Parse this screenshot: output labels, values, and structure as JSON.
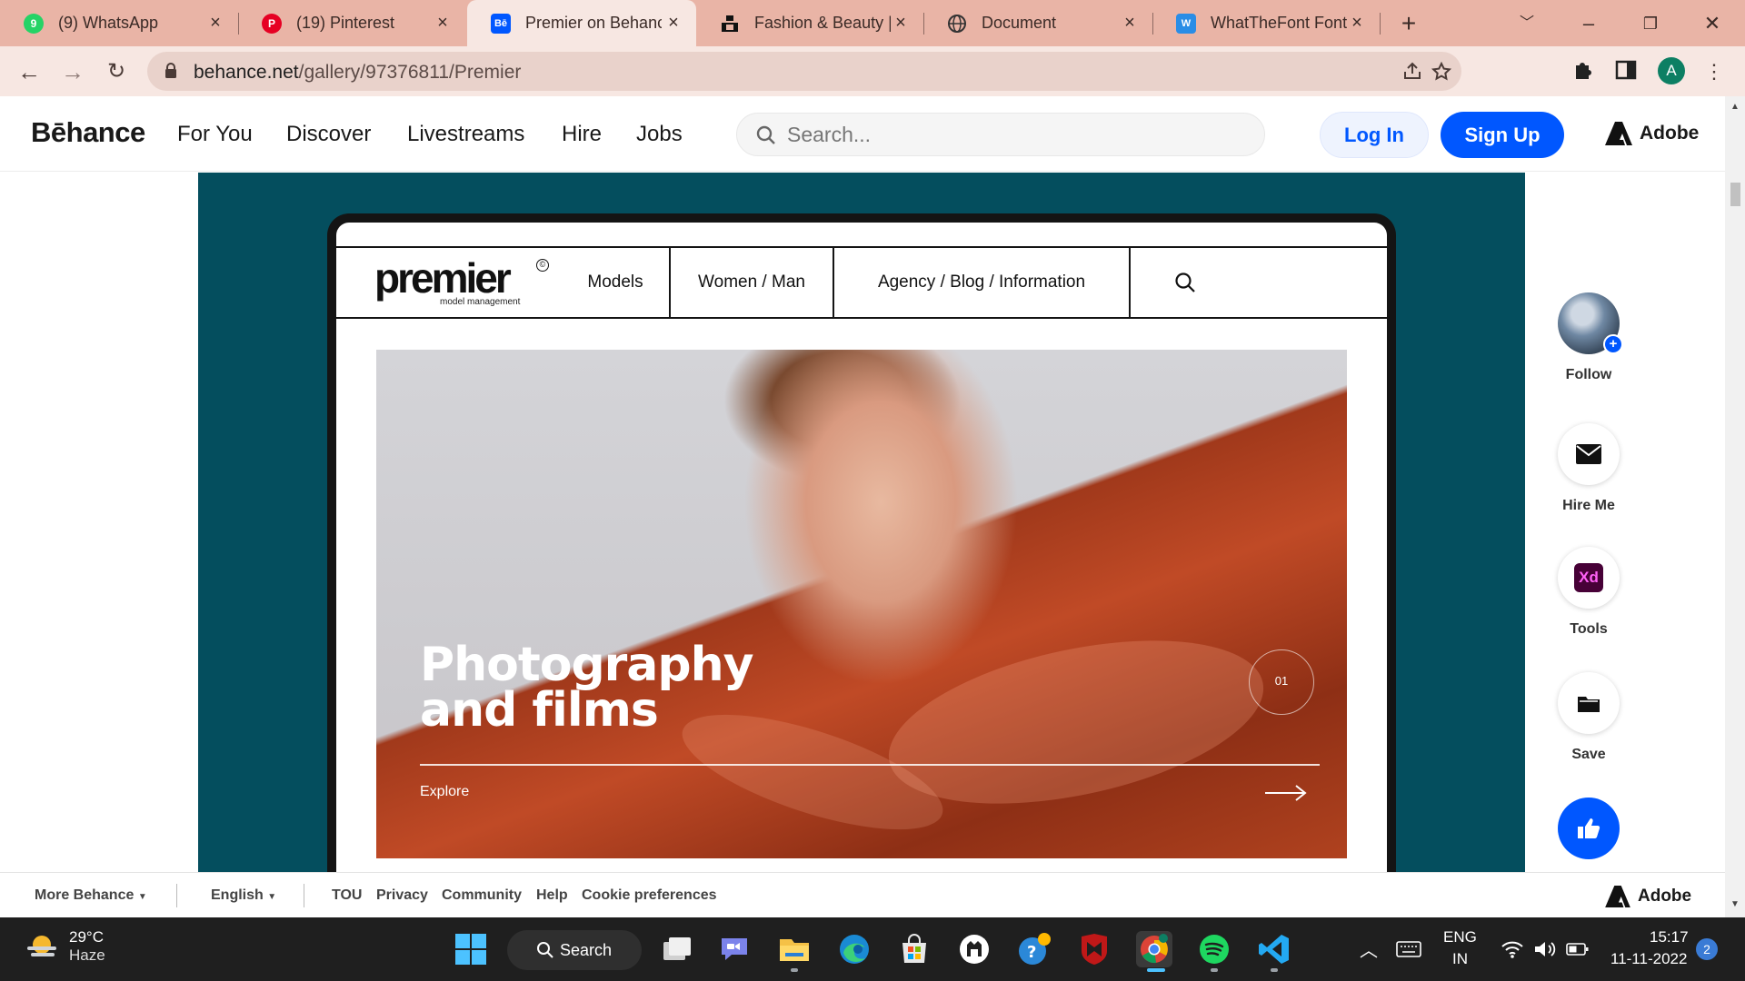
{
  "browser": {
    "tabs": [
      {
        "label": "(9) WhatsApp",
        "favicon": "whatsapp-icon",
        "color": "#25d366",
        "badge": "9"
      },
      {
        "label": "(19) Pinterest",
        "favicon": "pinterest-icon",
        "color": "#e60023",
        "badge": "P"
      },
      {
        "label": "Premier on Behance",
        "favicon": "behance-icon",
        "color": "#0057ff",
        "badge": "Bē",
        "active": true
      },
      {
        "label": "Fashion & Beauty |",
        "favicon": "unsplash-icon",
        "color": "#111111",
        "badge": ""
      },
      {
        "label": "Document",
        "favicon": "globe-icon",
        "color": "#444444",
        "badge": ""
      },
      {
        "label": "WhatTheFont Font",
        "favicon": "whatthefont-icon",
        "color": "#2a8de6",
        "badge": "W"
      }
    ],
    "url_host": "behance.net",
    "url_path": "/gallery/97376811/Premier",
    "profile_initial": "A"
  },
  "behance": {
    "logo": "Bēhance",
    "nav": [
      "For You",
      "Discover",
      "Livestreams",
      "Hire",
      "Jobs"
    ],
    "search_placeholder": "Search...",
    "login_label": "Log In",
    "signup_label": "Sign Up",
    "adobe_label": "Adobe"
  },
  "project": {
    "mock_logo_word": "premier",
    "mock_logo_sub": "model management",
    "mock_logo_mark": "©",
    "mock_nav": [
      "Models",
      "Women / Man",
      "Agency / Blog / Information"
    ],
    "hero_title": "Photography\nand  films",
    "hero_counter": "01",
    "hero_explore": "Explore"
  },
  "rail": {
    "follow": "Follow",
    "hire": "Hire Me",
    "tools": "Tools",
    "tools_badge": "Xd",
    "save": "Save"
  },
  "footer": {
    "more": "More Behance",
    "language": "English",
    "links": [
      "TOU",
      "Privacy",
      "Community",
      "Help",
      "Cookie preferences"
    ],
    "adobe_label": "Adobe"
  },
  "taskbar": {
    "weather_temp": "29°C",
    "weather_cond": "Haze",
    "search_label": "Search",
    "lang_line1": "ENG",
    "lang_line2": "IN",
    "time": "15:17",
    "date": "11-11-2022",
    "notifications": "2"
  },
  "colors": {
    "chrome_frame": "#e9b4a6",
    "behance_blue": "#0057ff",
    "project_bg": "#044e5e"
  }
}
